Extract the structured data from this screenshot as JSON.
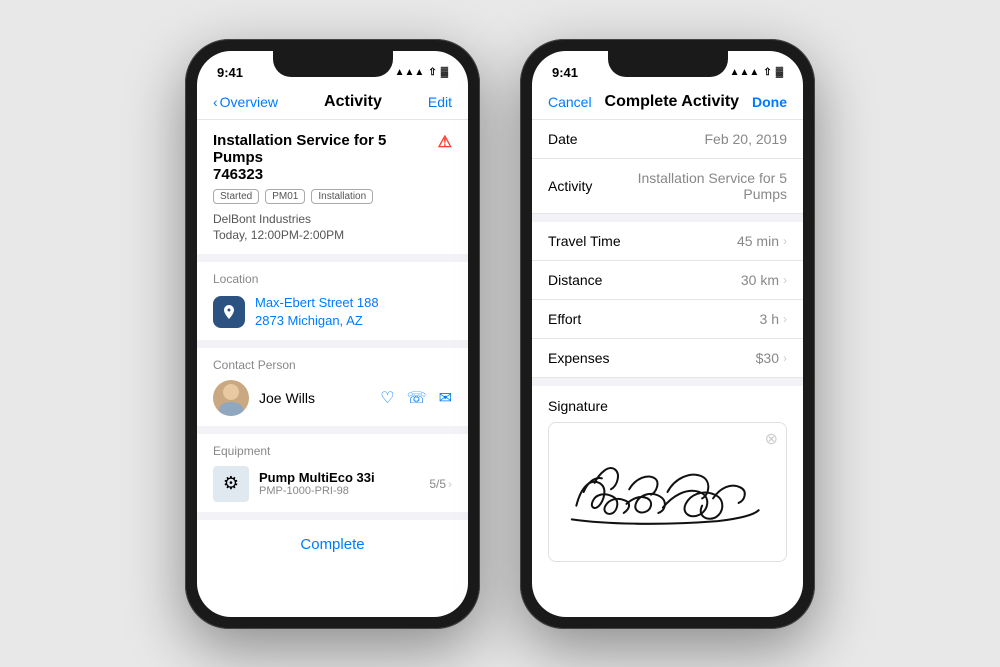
{
  "phone1": {
    "status": {
      "time": "9:41",
      "signal": "▲▲▲",
      "wifi": "◀",
      "battery": "▓"
    },
    "nav": {
      "back_label": "Overview",
      "title": "Activity",
      "action_label": "Edit"
    },
    "activity": {
      "title": "Installation Service for 5 Pumps",
      "id": "746323",
      "tags": [
        "Started",
        "PM01",
        "Installation"
      ],
      "company": "DelBont Industries",
      "time": "Today, 12:00PM-2:00PM"
    },
    "location": {
      "section_label": "Location",
      "address_line1": "Max-Ebert Street 188",
      "address_line2": "2873 Michigan, AZ"
    },
    "contact": {
      "section_label": "Contact Person",
      "name": "Joe Wills"
    },
    "equipment": {
      "section_label": "Equipment",
      "name": "Pump MultiEco 33i",
      "id": "PMP-1000-PRI-98",
      "count": "5/5"
    },
    "complete_button": "Complete"
  },
  "phone2": {
    "status": {
      "time": "9:41"
    },
    "nav": {
      "cancel_label": "Cancel",
      "title": "Complete Activity",
      "done_label": "Done"
    },
    "form": {
      "date_label": "Date",
      "date_value": "Feb 20, 2019",
      "activity_label": "Activity",
      "activity_value": "Installation Service for 5 Pumps",
      "travel_time_label": "Travel Time",
      "travel_time_value": "45 min",
      "distance_label": "Distance",
      "distance_value": "30 km",
      "effort_label": "Effort",
      "effort_value": "3 h",
      "expenses_label": "Expenses",
      "expenses_value": "$30",
      "signature_label": "Signature"
    }
  }
}
